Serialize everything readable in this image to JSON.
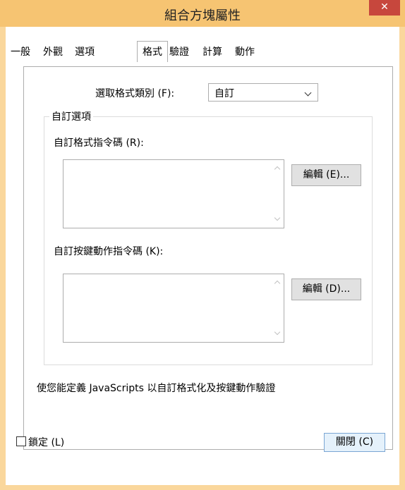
{
  "window": {
    "title": "組合方塊屬性",
    "close_glyph": "✕"
  },
  "tabs": [
    {
      "label": "一般"
    },
    {
      "label": "外觀"
    },
    {
      "label": "選項"
    },
    {
      "label": "格式",
      "selected": true
    },
    {
      "label": "驗證"
    },
    {
      "label": "計算"
    },
    {
      "label": "動作"
    }
  ],
  "format": {
    "category_label": "選取格式類別 (F):",
    "category_value": "自訂"
  },
  "custom_options": {
    "group_title": "自訂選項",
    "format_script_label": "自訂格式指令碼 (R):",
    "format_script_value": "",
    "edit_format_button": "編輯 (E)...",
    "keystroke_script_label": "自訂按鍵動作指令碼 (K):",
    "keystroke_script_value": "",
    "edit_keystroke_button": "編輯 (D)..."
  },
  "description": "使您能定義 JavaScripts 以自訂格式化及按鍵動作驗證",
  "footer": {
    "lock_label": "鎖定 (L)",
    "lock_checked": false,
    "close_button": "關閉 (C)"
  },
  "colors": {
    "title_bar": "#f6c472",
    "close_button": "#c7473d",
    "default_button_border": "#7aa6d4"
  }
}
